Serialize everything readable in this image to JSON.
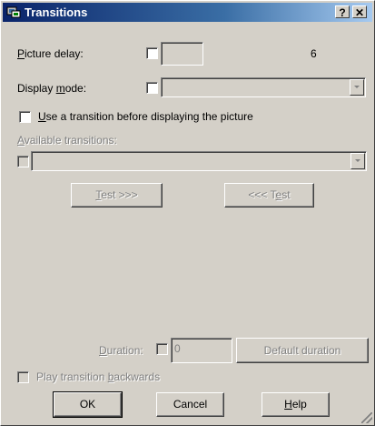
{
  "window": {
    "title": "Transitions",
    "help_button": "?",
    "close_button": "✕"
  },
  "picture_delay": {
    "label_prefix": "",
    "label_underline": "P",
    "label_rest": "icture delay:",
    "value": "6"
  },
  "display_mode": {
    "label_prefix": "Display ",
    "label_underline": "m",
    "label_rest": "ode:",
    "selected": ""
  },
  "use_transition": {
    "label_underline": "U",
    "label_rest": "se a transition before displaying the picture"
  },
  "available_transitions": {
    "label_prefix": "",
    "label_underline": "A",
    "label_rest": "vailable transitions:",
    "selected": ""
  },
  "test_forward": {
    "label_underline": "T",
    "label_rest": "est >>>"
  },
  "test_backward": {
    "label_prefix": "<<< T",
    "label_underline": "e",
    "label_rest": "st"
  },
  "duration": {
    "label_underline": "D",
    "label_rest": "uration:",
    "value": "0",
    "default_button": "Default duration"
  },
  "play_backwards": {
    "label_prefix": "Play transition ",
    "label_underline": "b",
    "label_rest": "ackwards"
  },
  "buttons": {
    "ok": "OK",
    "cancel": "Cancel",
    "help_underline": "H",
    "help_rest": "elp"
  }
}
